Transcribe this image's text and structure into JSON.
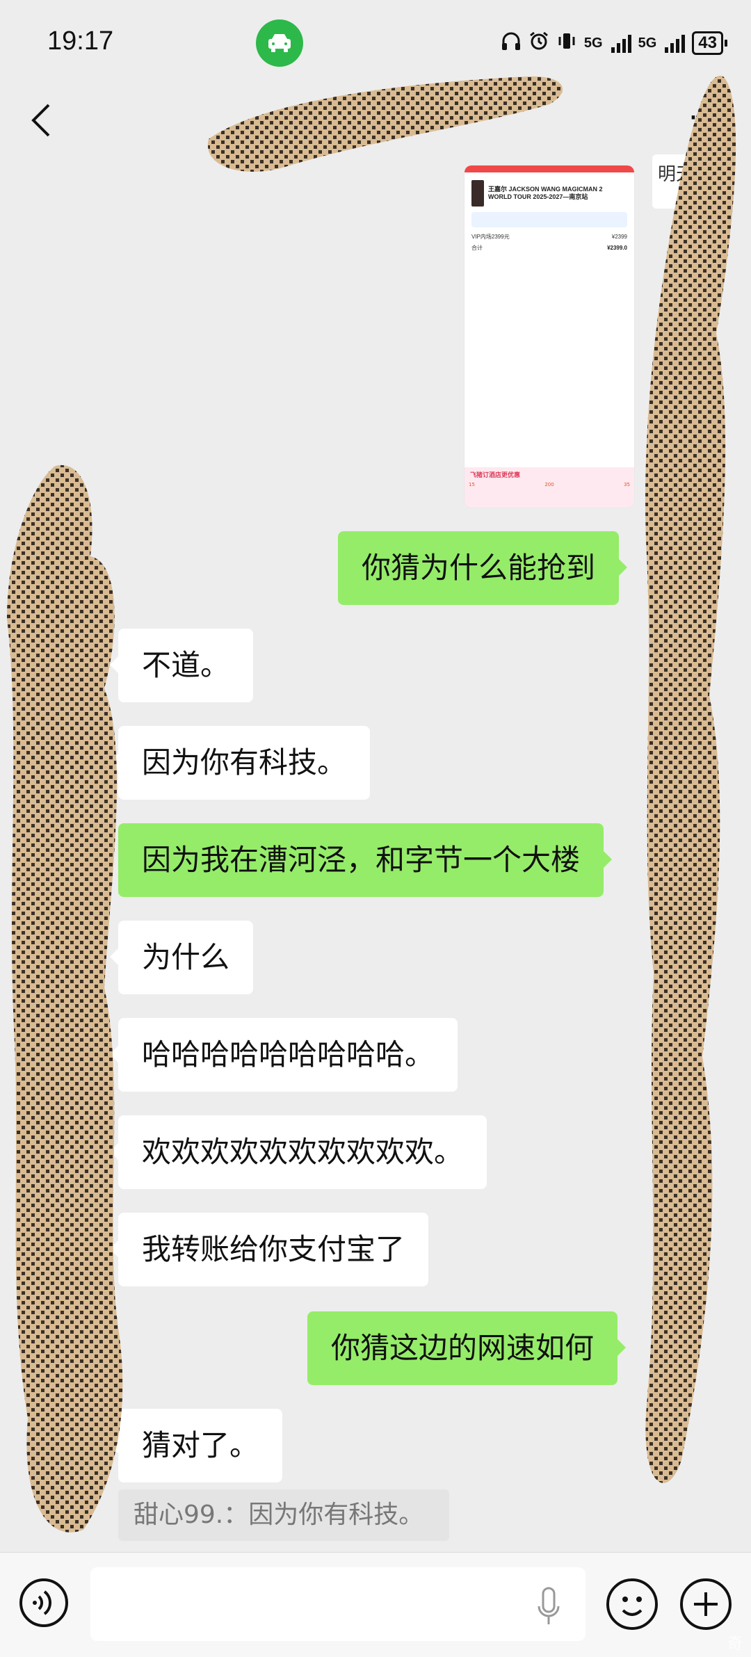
{
  "status_bar": {
    "time": "19:17",
    "signal_1": "5G",
    "signal_2": "5G",
    "battery": "43"
  },
  "header": {
    "more_label": "···"
  },
  "shared_screenshot": {
    "singer_title": "王嘉尔 JACKSON WANG MAGICMAN 2 WORLD TOUR 2025-2027—南京站",
    "price_line": "VIP内场2399元",
    "price_value": "¥2399",
    "total_label": "合计",
    "total_value": "¥2399.0",
    "hotel_banner": "飞猪订酒店更优惠",
    "promo_1": "15",
    "promo_2": "200",
    "promo_3": "35"
  },
  "mini_photo_text": "明天",
  "messages": [
    {
      "side": "me",
      "text": "你猜为什么能抢到"
    },
    {
      "side": "other",
      "text": "不道。"
    },
    {
      "side": "other",
      "text": "因为你有科技。"
    },
    {
      "side": "me",
      "text": "因为我在漕河泾，和字节一个大楼"
    },
    {
      "side": "other",
      "text": "为什么"
    },
    {
      "side": "other",
      "text": "哈哈哈哈哈哈哈哈哈。"
    },
    {
      "side": "other",
      "text": "欢欢欢欢欢欢欢欢欢欢。"
    },
    {
      "side": "other",
      "text": "我转账给你支付宝了"
    },
    {
      "side": "me",
      "text": "你猜这边的网速如何"
    },
    {
      "side": "other",
      "text": "猜对了。"
    }
  ],
  "quote": "甜心99.：因为你有科技。",
  "input": {
    "value": "",
    "placeholder": ""
  },
  "watermark": "奇"
}
